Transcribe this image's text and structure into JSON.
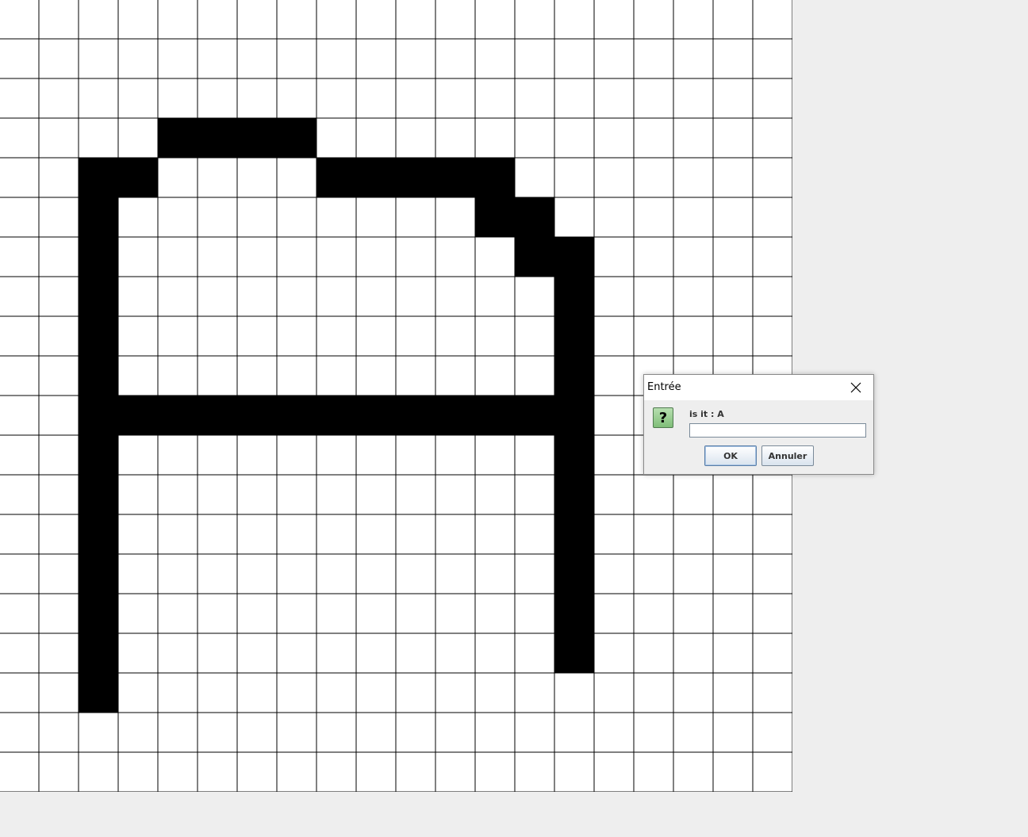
{
  "grid": {
    "rows": 20,
    "cols": 20,
    "filled_color": "#000000",
    "empty_color": "#ffffff",
    "line_color": "#000000",
    "filled_cells": [
      [
        3,
        4
      ],
      [
        3,
        5
      ],
      [
        3,
        6
      ],
      [
        3,
        7
      ],
      [
        4,
        2
      ],
      [
        4,
        3
      ],
      [
        4,
        8
      ],
      [
        4,
        9
      ],
      [
        4,
        10
      ],
      [
        4,
        11
      ],
      [
        4,
        12
      ],
      [
        5,
        2
      ],
      [
        5,
        12
      ],
      [
        5,
        13
      ],
      [
        6,
        2
      ],
      [
        6,
        13
      ],
      [
        6,
        14
      ],
      [
        7,
        2
      ],
      [
        7,
        14
      ],
      [
        8,
        2
      ],
      [
        8,
        14
      ],
      [
        9,
        2
      ],
      [
        9,
        14
      ],
      [
        10,
        2
      ],
      [
        10,
        3
      ],
      [
        10,
        4
      ],
      [
        10,
        5
      ],
      [
        10,
        6
      ],
      [
        10,
        7
      ],
      [
        10,
        8
      ],
      [
        10,
        9
      ],
      [
        10,
        10
      ],
      [
        10,
        11
      ],
      [
        10,
        12
      ],
      [
        10,
        13
      ],
      [
        10,
        14
      ],
      [
        11,
        2
      ],
      [
        11,
        14
      ],
      [
        12,
        2
      ],
      [
        12,
        14
      ],
      [
        13,
        2
      ],
      [
        13,
        14
      ],
      [
        14,
        2
      ],
      [
        14,
        14
      ],
      [
        15,
        2
      ],
      [
        15,
        14
      ],
      [
        16,
        2
      ],
      [
        16,
        14
      ],
      [
        17,
        2
      ]
    ]
  },
  "dialog": {
    "title": "Entrée",
    "icon": "question-icon",
    "icon_glyph": "?",
    "prompt": "is it : A",
    "input_value": "",
    "ok_label": "OK",
    "cancel_label": "Annuler",
    "close_icon": "close-icon"
  }
}
